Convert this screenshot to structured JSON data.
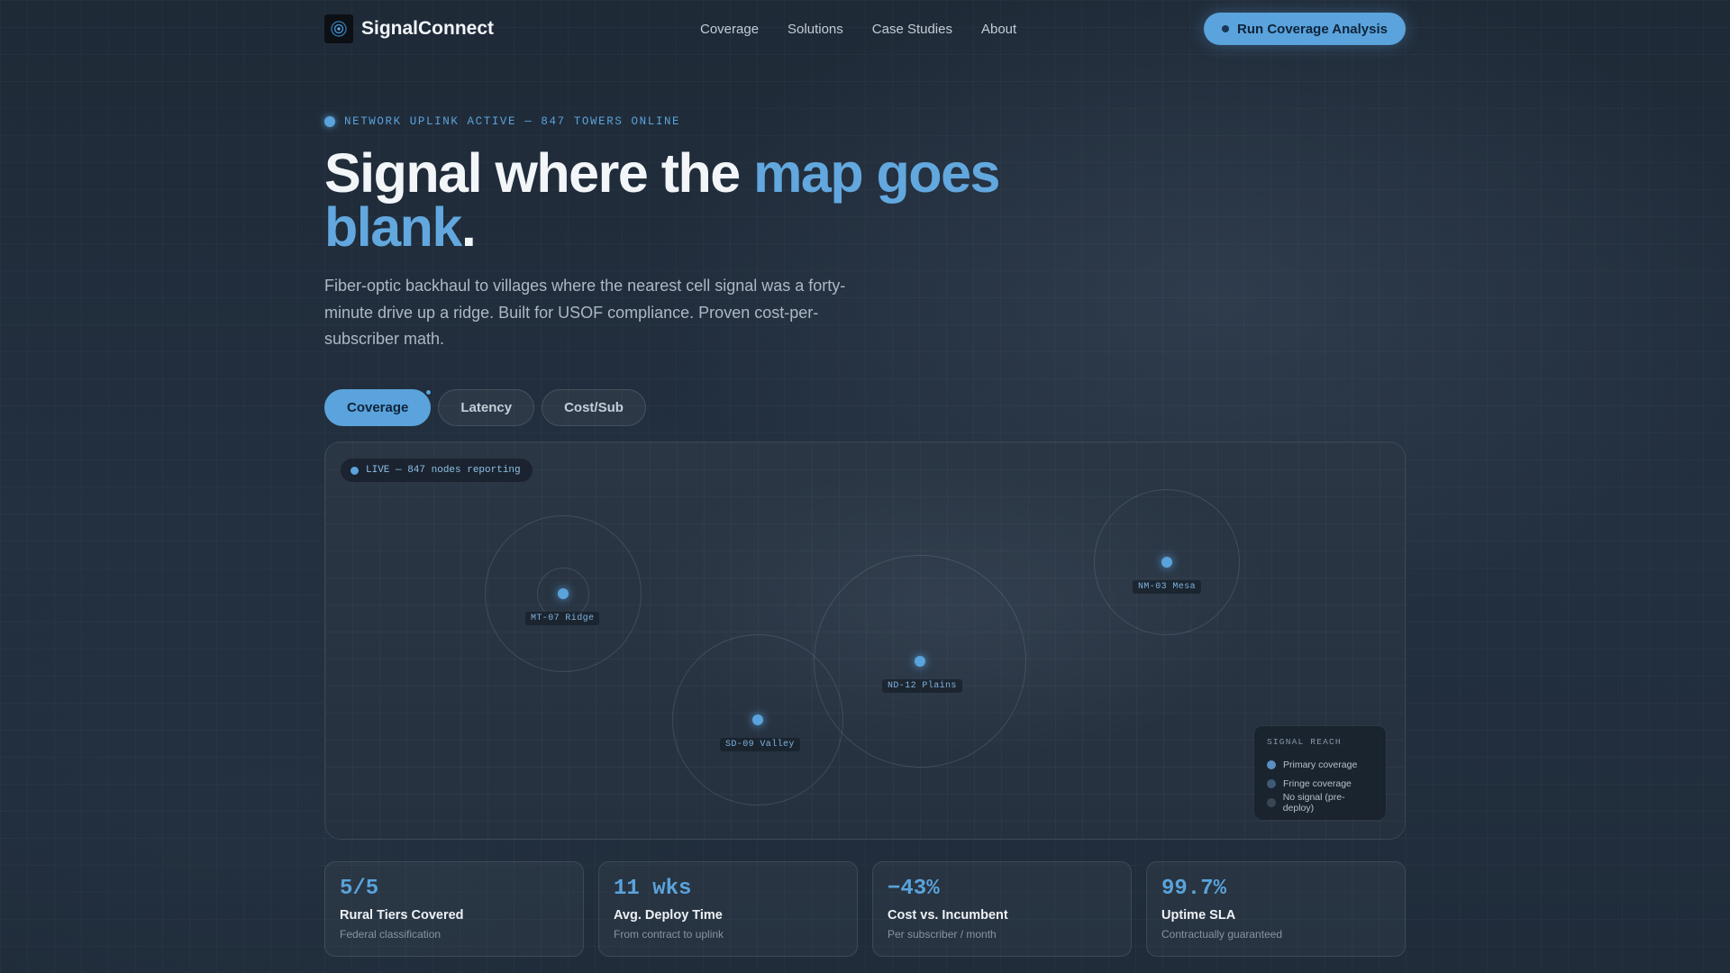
{
  "brand": {
    "name": "SignalConnect"
  },
  "nav": {
    "links": [
      "Coverage",
      "Solutions",
      "Case Studies",
      "About"
    ],
    "cta": "Run Coverage Analysis"
  },
  "hero": {
    "status": "NETWORK UPLINK ACTIVE — 847 TOWERS ONLINE",
    "headline_part1": "Signal where the ",
    "headline_accent": "map goes blank",
    "headline_end": ".",
    "subtitle": "Fiber-optic backhaul to villages where the nearest cell signal was a forty-minute drive up a ridge. Built for USOF compliance. Proven cost-per-subscriber math."
  },
  "tabs": [
    "Coverage",
    "Latency",
    "Cost/Sub"
  ],
  "map": {
    "live": "LIVE — 847 nodes reporting",
    "nodes": [
      {
        "label": "MT-07 Ridge"
      },
      {
        "label": "SD-09 Valley"
      },
      {
        "label": "ND-12 Plains"
      },
      {
        "label": "NM-03 Mesa"
      }
    ],
    "legend": {
      "title": "SIGNAL REACH",
      "items": [
        {
          "label": "Primary coverage",
          "color": "#5a8fc0"
        },
        {
          "label": "Fringe coverage",
          "color": "#3d5a76"
        },
        {
          "label": "No signal (pre-deploy)",
          "color": "#3a4654"
        }
      ]
    }
  },
  "stats": [
    {
      "value": "5/5",
      "label": "Rural Tiers Covered",
      "sub": "Federal classification"
    },
    {
      "value": "11 wks",
      "label": "Avg. Deploy Time",
      "sub": "From contract to uplink"
    },
    {
      "value": "−43%",
      "label": "Cost vs. Incumbent",
      "sub": "Per subscriber / month"
    },
    {
      "value": "99.7%",
      "label": "Uptime SLA",
      "sub": "Contractually guaranteed"
    }
  ],
  "colors": {
    "accent": "#5aa3dc",
    "background": "#1f2a37"
  }
}
